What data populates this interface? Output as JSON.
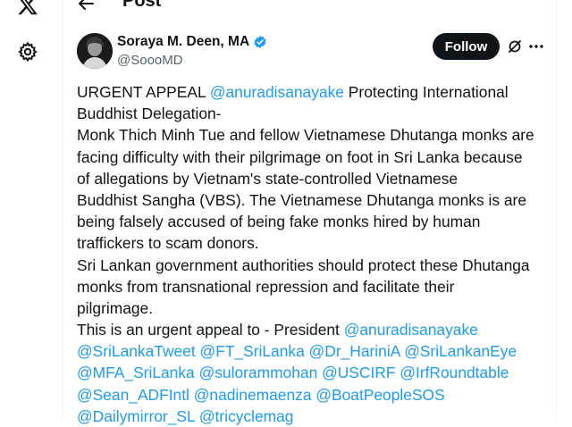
{
  "left_nav": {
    "icons": [
      "x-logo-icon",
      "gear-icon"
    ]
  },
  "header": {
    "title": "Post"
  },
  "author": {
    "name": "Soraya M. Deen, MA",
    "handle": "@SoooMD",
    "verified": true
  },
  "actions": {
    "follow_label": "Follow"
  },
  "colors": {
    "mention": "#1d9bf0",
    "text": "#0f1419",
    "muted": "#536471",
    "verified": "#1d9bf0"
  },
  "post": {
    "lines": [
      [
        {
          "t": "URGENT APPEAL "
        },
        {
          "t": "@anuradisanayake",
          "m": true
        },
        {
          "t": " Protecting International"
        }
      ],
      [
        {
          "t": "Buddhist Delegation-"
        }
      ],
      [
        {
          "t": "Monk Thich Minh Tue and fellow Vietnamese Dhutanga monks are"
        }
      ],
      [
        {
          "t": "facing difficulty with their pilgrimage on foot in Sri Lanka because"
        }
      ],
      [
        {
          "t": "of  allegations by Vietnam's state-controlled Vietnamese"
        }
      ],
      [
        {
          "t": "Buddhist Sangha (VBS). The Vietnamese Dhutanga monks is are"
        }
      ],
      [
        {
          "t": "being falsely accused of being fake monks hired by human"
        }
      ],
      [
        {
          "t": "traffickers to scam donors."
        }
      ],
      [
        {
          "t": "Sri Lankan government authorities should protect these Dhutanga"
        }
      ],
      [
        {
          "t": "monks from transnational repression and facilitate their"
        }
      ],
      [
        {
          "t": "pilgrimage."
        }
      ],
      [
        {
          "t": "This is an urgent appeal to - President "
        },
        {
          "t": "@anuradisanayake",
          "m": true
        }
      ],
      [
        {
          "t": "@SriLankaTweet",
          "m": true
        },
        {
          "t": " "
        },
        {
          "t": "@FT_SriLanka",
          "m": true
        },
        {
          "t": " "
        },
        {
          "t": "@Dr_HariniA",
          "m": true
        },
        {
          "t": " "
        },
        {
          "t": "@SriLankanEye",
          "m": true
        }
      ],
      [
        {
          "t": "@MFA_SriLanka",
          "m": true
        },
        {
          "t": " "
        },
        {
          "t": "@sulorammohan",
          "m": true
        },
        {
          "t": " "
        },
        {
          "t": "@USCIRF",
          "m": true
        },
        {
          "t": " "
        },
        {
          "t": "@IrfRoundtable",
          "m": true
        }
      ],
      [
        {
          "t": "@Sean_ADFIntl",
          "m": true
        },
        {
          "t": " "
        },
        {
          "t": "@nadinemaenza",
          "m": true
        },
        {
          "t": " "
        },
        {
          "t": "@BoatPeopleSOS",
          "m": true
        }
      ],
      [
        {
          "t": "@Dailymirror_SL",
          "m": true
        },
        {
          "t": " "
        },
        {
          "t": "@tricyclemag",
          "m": true
        }
      ]
    ]
  }
}
